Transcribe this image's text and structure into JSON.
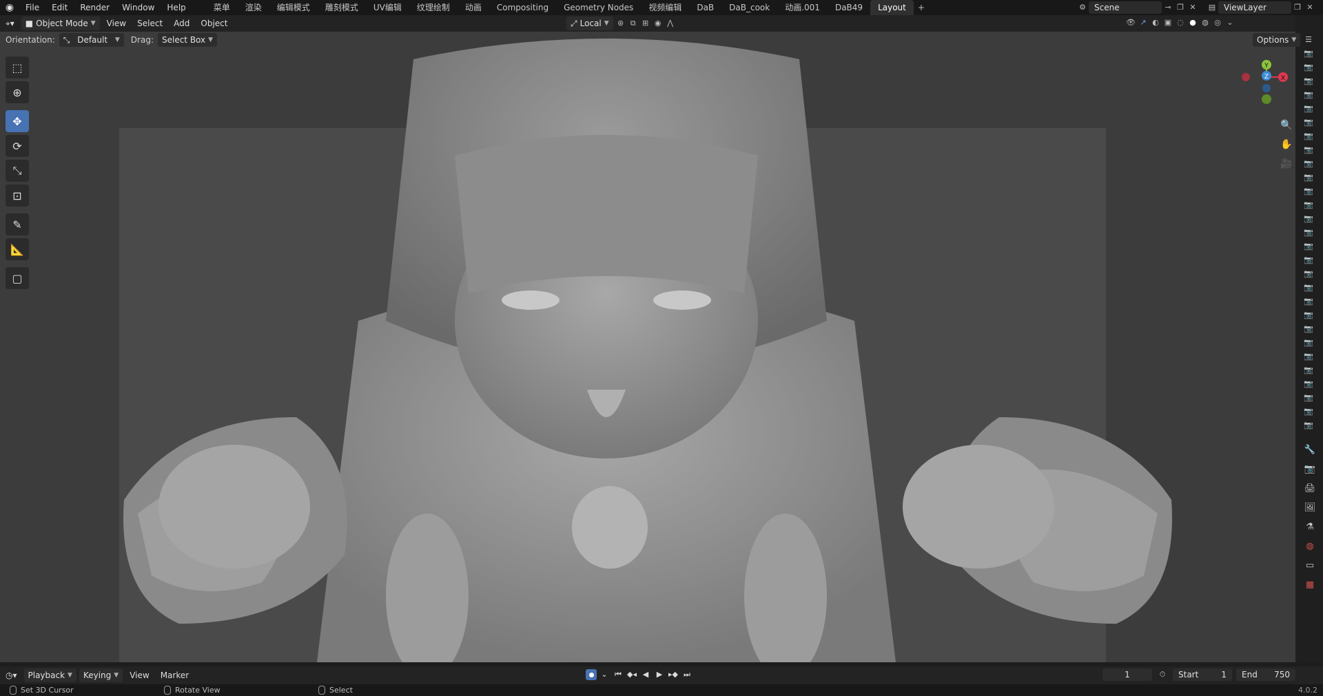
{
  "menu": [
    "File",
    "Edit",
    "Render",
    "Window",
    "Help"
  ],
  "workspace_tabs": [
    "菜单",
    "渲染",
    "编辑模式",
    "雕刻模式",
    "UV编辑",
    "纹理绘制",
    "动画",
    "Compositing",
    "Geometry Nodes",
    "视频编辑",
    "DaB",
    "DaB_cook",
    "动画.001",
    "DaB49",
    "Layout"
  ],
  "active_tab": "Layout",
  "scene": "Scene",
  "view_layer": "ViewLayer",
  "header": {
    "mode": "Object Mode",
    "view": "View",
    "select": "Select",
    "add": "Add",
    "object": "Object",
    "pivot": "Local",
    "options": "Options"
  },
  "subheader": {
    "orientation_label": "Orientation:",
    "orientation_value": "Default",
    "drag_label": "Drag:",
    "drag_value": "Select Box"
  },
  "gizmo": {
    "y": "Y",
    "z": "Z",
    "x": "X"
  },
  "timeline": {
    "playback": "Playback",
    "keying": "Keying",
    "view": "View",
    "marker": "Marker",
    "current_frame": "1",
    "start_label": "Start",
    "start_value": "1",
    "end_label": "End",
    "end_value": "750"
  },
  "status": {
    "left": "Set 3D Cursor",
    "middle": "Rotate View",
    "right": "Select",
    "version": "4.0.2"
  },
  "colors": {
    "accent": "#4772b3",
    "axis_x": "#e0384f",
    "axis_y": "#8bc33d",
    "axis_z": "#3d8bd6"
  }
}
